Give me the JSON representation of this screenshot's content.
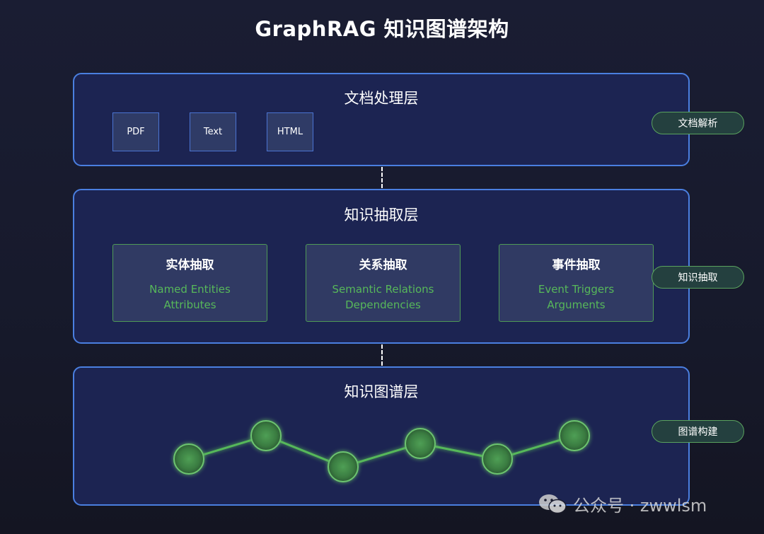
{
  "title": "GraphRAG 知识图谱架构",
  "layers": [
    {
      "title": "文档处理层",
      "items": [
        "PDF",
        "Text",
        "HTML"
      ],
      "tag": "文档解析"
    },
    {
      "title": "知识抽取层",
      "items": [
        {
          "title": "实体抽取",
          "lines": [
            "Named Entities",
            "Attributes"
          ]
        },
        {
          "title": "关系抽取",
          "lines": [
            "Semantic Relations",
            "Dependencies"
          ]
        },
        {
          "title": "事件抽取",
          "lines": [
            "Event Triggers",
            "Arguments"
          ]
        }
      ],
      "tag": "知识抽取"
    },
    {
      "title": "知识图谱层",
      "node_count": 6,
      "tag": "图谱构建"
    }
  ],
  "watermark": {
    "text": "公众号 · zwwlsm",
    "icon": "wechat-icon"
  },
  "colors": {
    "background": "#181b2e",
    "layer_border": "#4a7fe0",
    "layer_fill": "#1c2452",
    "accent_green": "#57b85a",
    "node_fill": "#3e8a45"
  }
}
